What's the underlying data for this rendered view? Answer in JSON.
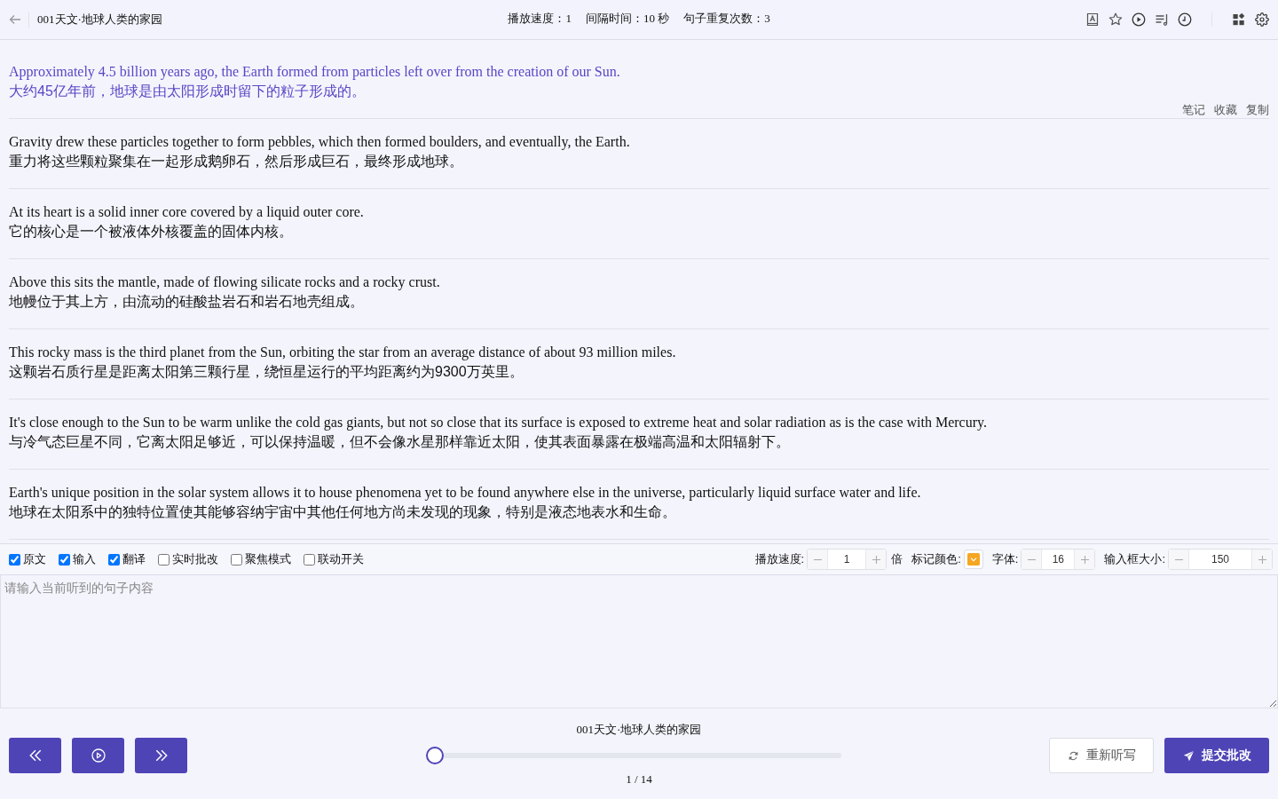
{
  "header": {
    "title": "001天文·地球人类的家园",
    "stats": [
      "播放速度：1",
      "间隔时间：10 秒",
      "句子重复次数：3"
    ]
  },
  "sentences": [
    {
      "english": "Approximately 4.5 billion years ago, the Earth formed from particles left over from the creation of our Sun.",
      "chinese": "大约45亿年前，地球是由太阳形成时留下的粒子形成的。",
      "selected": true
    },
    {
      "english": "Gravity drew these particles together to form pebbles, which then formed boulders, and eventually, the Earth.",
      "chinese": "重力将这些颗粒聚集在一起形成鹅卵石，然后形成巨石，最终形成地球。",
      "selected": false
    },
    {
      "english": "At its heart is a solid inner core covered by a liquid outer core.",
      "chinese": "它的核心是一个被液体外核覆盖的固体内核。",
      "selected": false
    },
    {
      "english": "Above this sits the mantle, made of flowing silicate rocks and a rocky crust.",
      "chinese": "地幔位于其上方，由流动的硅酸盐岩石和岩石地壳组成。",
      "selected": false
    },
    {
      "english": "This rocky mass is the third planet from the Sun, orbiting the star from an average distance of about 93 million miles.",
      "chinese": "这颗岩石质行星是距离太阳第三颗行星，绕恒星运行的平均距离约为9300万英里。",
      "selected": false
    },
    {
      "english": "It's close enough to the Sun to be warm unlike the cold gas giants, but not so close that its surface is exposed to extreme heat and solar radiation as is the case with Mercury.",
      "chinese": "与冷气态巨星不同，它离太阳足够近，可以保持温暖，但不会像水星那样靠近太阳，使其表面暴露在极端高温和太阳辐射下。",
      "selected": false
    },
    {
      "english": "Earth's unique position in the solar system allows it to house phenomena yet to be found anywhere else in the universe, particularly liquid surface water and life.",
      "chinese": "地球在太阳系中的独特位置使其能够容纳宇宙中其他任何地方尚未发现的现象，特别是液态地表水和生命。",
      "selected": false
    }
  ],
  "sentence_actions": [
    "笔记",
    "收藏",
    "复制"
  ],
  "options": [
    {
      "label": "原文",
      "checked": true
    },
    {
      "label": "输入",
      "checked": true
    },
    {
      "label": "翻译",
      "checked": true
    },
    {
      "label": "实时批改",
      "checked": false
    },
    {
      "label": "聚焦模式",
      "checked": false
    },
    {
      "label": "联动开关",
      "checked": false
    }
  ],
  "settings": [
    {
      "kind": "stepper",
      "label": "播放速度:",
      "value": "1",
      "unit": "倍"
    },
    {
      "kind": "color",
      "label": "标记颜色:",
      "color": "#f5a623"
    },
    {
      "kind": "stepper",
      "label": "字体:",
      "value": "16"
    },
    {
      "kind": "stepper",
      "label": "输入框大小:",
      "value": "150"
    }
  ],
  "input": {
    "placeholder": "请输入当前听到的句子内容"
  },
  "player": {
    "title": "001天文·地球人类的家园",
    "level": 0,
    "position": "1 / 14"
  },
  "buttons": [
    {
      "kind": "secondary",
      "label": "重新听写"
    },
    {
      "kind": "primary",
      "label": "提交批改"
    }
  ]
}
